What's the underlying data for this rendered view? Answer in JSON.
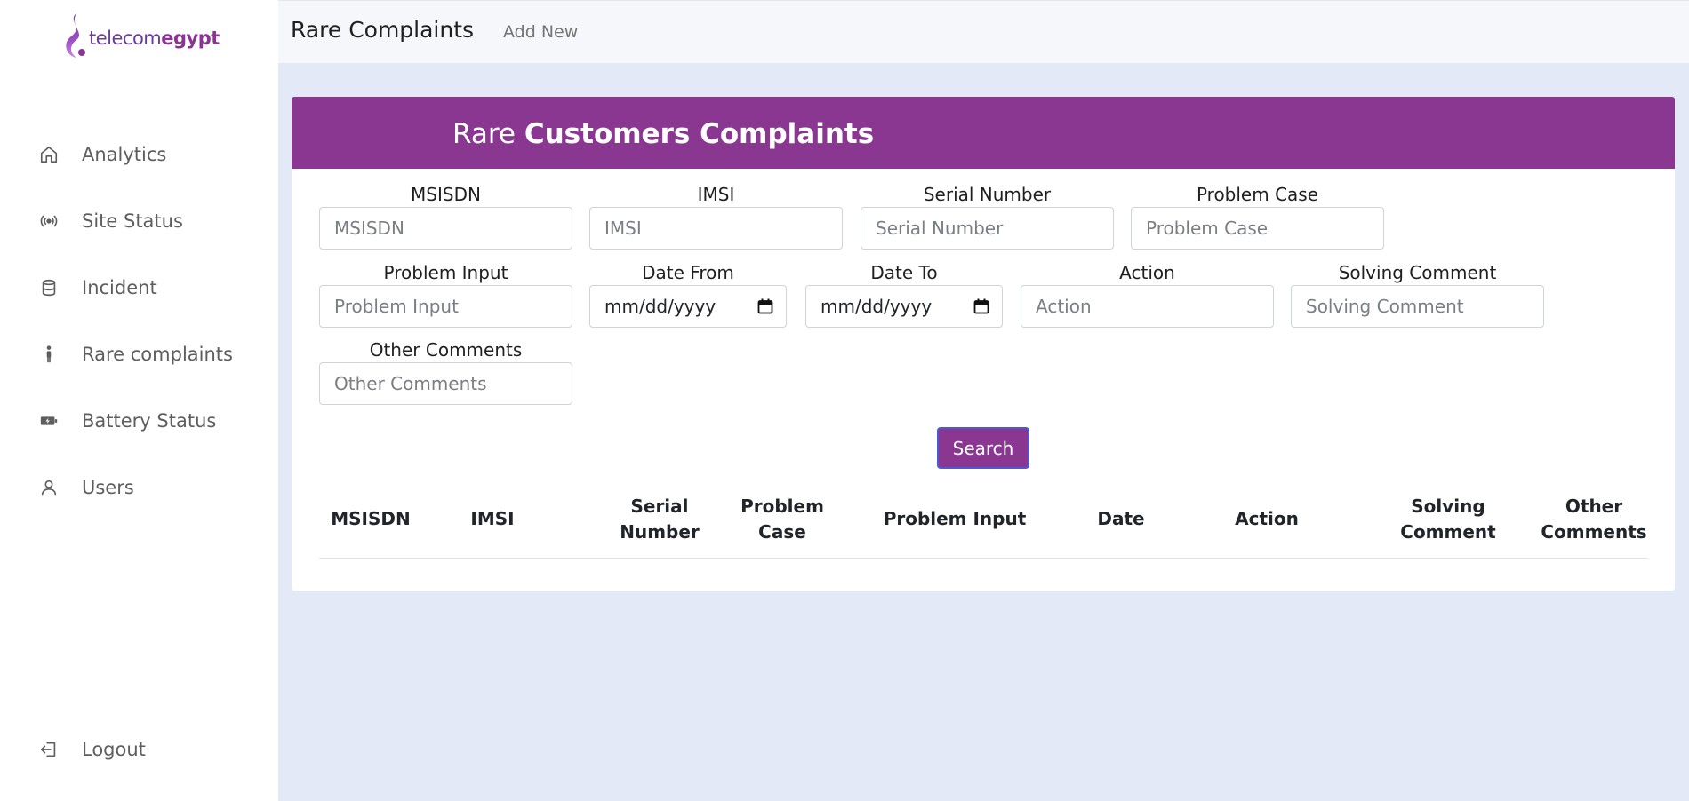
{
  "brand": {
    "text_light": "telecom",
    "text_bold": "egypt",
    "icon": "telecom-egypt-logo"
  },
  "sidebar": {
    "items": [
      {
        "label": "Analytics",
        "icon": "home-icon"
      },
      {
        "label": "Site Status",
        "icon": "broadcast-icon"
      },
      {
        "label": "Incident",
        "icon": "database-icon"
      },
      {
        "label": "Rare complaints",
        "icon": "person-icon"
      },
      {
        "label": "Battery Status",
        "icon": "battery-charging-icon"
      },
      {
        "label": "Users",
        "icon": "user-icon"
      }
    ],
    "logout": {
      "label": "Logout",
      "icon": "logout-icon"
    }
  },
  "header": {
    "title": "Rare Complaints",
    "add_new": "Add New"
  },
  "card": {
    "title_light": "Rare",
    "title_bold": "Customers Complaints"
  },
  "form": {
    "msisdn": {
      "label": "MSISDN",
      "placeholder": "MSISDN",
      "value": ""
    },
    "imsi": {
      "label": "IMSI",
      "placeholder": "IMSI",
      "value": ""
    },
    "serial_number": {
      "label": "Serial Number",
      "placeholder": "Serial Number",
      "value": ""
    },
    "problem_case": {
      "label": "Problem Case",
      "placeholder": "Problem Case",
      "value": ""
    },
    "problem_input": {
      "label": "Problem Input",
      "placeholder": "Problem Input",
      "value": ""
    },
    "date_from": {
      "label": "Date From",
      "value": "mm/dd/yyyy"
    },
    "date_to": {
      "label": "Date To",
      "value": "mm/dd/yyyy"
    },
    "action": {
      "label": "Action",
      "placeholder": "Action",
      "value": ""
    },
    "solving_comment": {
      "label": "Solving Comment",
      "placeholder": "Solving Comment",
      "value": ""
    },
    "other_comments": {
      "label": "Other Comments",
      "placeholder": "Other Comments",
      "value": ""
    },
    "search_label": "Search"
  },
  "table": {
    "columns": [
      {
        "line1": "MSISDN",
        "line2": ""
      },
      {
        "line1": "IMSI",
        "line2": ""
      },
      {
        "line1": "Serial",
        "line2": "Number"
      },
      {
        "line1": "Problem",
        "line2": "Case"
      },
      {
        "line1": "Problem Input",
        "line2": ""
      },
      {
        "line1": "Date",
        "line2": ""
      },
      {
        "line1": "Action",
        "line2": ""
      },
      {
        "line1": "Solving",
        "line2": "Comment"
      },
      {
        "line1": "Other",
        "line2": "Comments"
      }
    ],
    "rows": []
  },
  "colors": {
    "brand_purple": "#8a3792",
    "background": "#e3e9f6",
    "focus_border": "#4a5ad6"
  }
}
